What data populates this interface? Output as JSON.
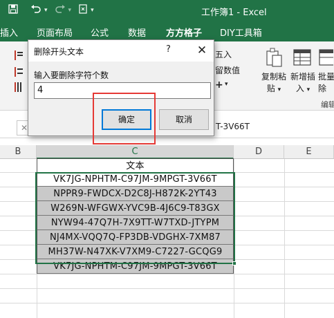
{
  "window": {
    "title": "工作簿1 - Excel"
  },
  "quick_access": {
    "save_icon": "save-icon",
    "undo_icon": "undo-icon",
    "redo_icon": "redo-icon",
    "format_icon": "format-painter-icon"
  },
  "tabs": [
    {
      "label": "插入"
    },
    {
      "label": "页面布局"
    },
    {
      "label": "公式"
    },
    {
      "label": "数据"
    },
    {
      "label": "方方格子"
    },
    {
      "label": "DIY工具箱"
    }
  ],
  "ribbon": {
    "insert_label": "五入",
    "keep_value_label": "留数值",
    "copy_paste_label": "复制粘",
    "copy_paste_sub": "贴",
    "new_insert_label": "新增插",
    "new_insert_sub": "入",
    "batch_delete_label": "批量",
    "batch_delete_sub": "除",
    "group_edit_label": "编辑"
  },
  "formula_bar": {
    "content": "T-3V66T"
  },
  "columns": [
    {
      "label": "B"
    },
    {
      "label": "C"
    },
    {
      "label": "D"
    },
    {
      "label": "E"
    }
  ],
  "sheet": {
    "header": "文本",
    "rows": [
      "VK7JG-NPHTM-C97JM-9MPGT-3V66T",
      "NPPR9-FWDCX-D2C8J-H872K-2YT43",
      "W269N-WFGWX-YVC9B-4J6C9-T83GX",
      "NYW94-47Q7H-7X9TT-W7TXD-JTYPM",
      "NJ4MX-VQQ7Q-FP3DB-VDGHX-7XM87",
      "MH37W-N47XK-V7XM9-C7227-GCQG9",
      "VK7JG-NPHTM-C97JM-9MPGT-3V66T"
    ]
  },
  "dialog": {
    "title": "删除开头文本",
    "help": "?",
    "close": "✕",
    "prompt": "输入要删除字符个数",
    "input_value": "4",
    "ok_label": "确定",
    "cancel_label": "取消"
  },
  "colors": {
    "excel_green": "#217346",
    "highlight_red": "#e53935",
    "default_button_border": "#0078d7"
  }
}
